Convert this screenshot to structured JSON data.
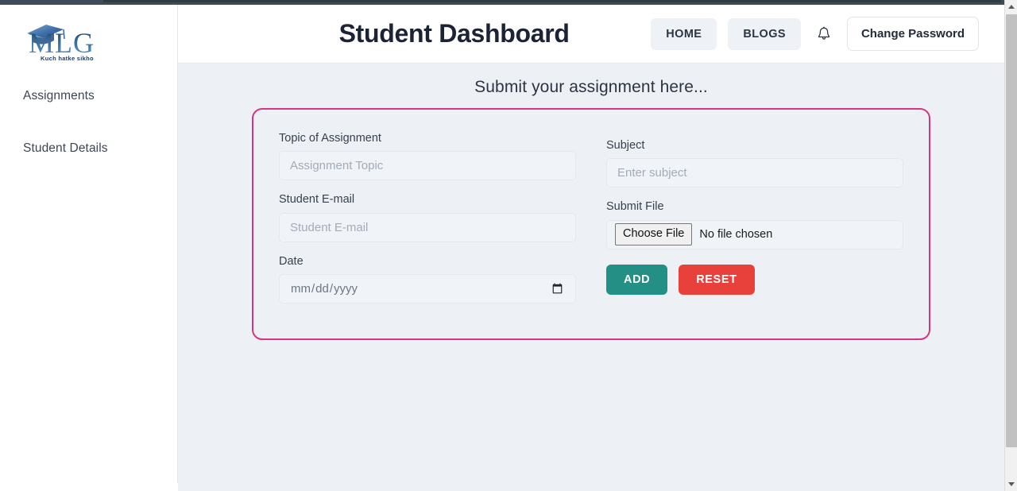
{
  "sidebar": {
    "logo": {
      "text": "MLG",
      "tagline": "Kuch hatke sikho",
      "icon": "graduation-cap-icon"
    },
    "items": [
      {
        "label": "Assignments"
      },
      {
        "label": "Student Details"
      }
    ]
  },
  "header": {
    "title": "Student Dashboard",
    "nav": [
      {
        "label": "HOME"
      },
      {
        "label": "BLOGS"
      }
    ],
    "notification_icon": "bell-icon",
    "change_password_label": "Change Password"
  },
  "main": {
    "section_title": "Submit your assignment here...",
    "form": {
      "topic": {
        "label": "Topic of Assignment",
        "placeholder": "Assignment Topic",
        "value": ""
      },
      "subject": {
        "label": "Subject",
        "placeholder": "Enter subject",
        "value": ""
      },
      "email": {
        "label": "Student E-mail",
        "placeholder": "Student E-mail",
        "value": ""
      },
      "file": {
        "label": "Submit File",
        "button_label": "Choose File",
        "status": "No file chosen"
      },
      "date": {
        "label": "Date",
        "placeholder": "mm/dd/yyyy",
        "value": ""
      },
      "submit_label": "ADD",
      "reset_label": "RESET"
    }
  },
  "colors": {
    "card_border": "#d6357f",
    "add_button": "#248f84",
    "reset_button": "#e8413c",
    "content_bg": "#edf1f5",
    "title_text": "#1b2335",
    "top_strip": "#3b4c54"
  },
  "scrollbar": {
    "up_icon": "chevron-up-icon",
    "down_icon": "chevron-down-icon"
  }
}
